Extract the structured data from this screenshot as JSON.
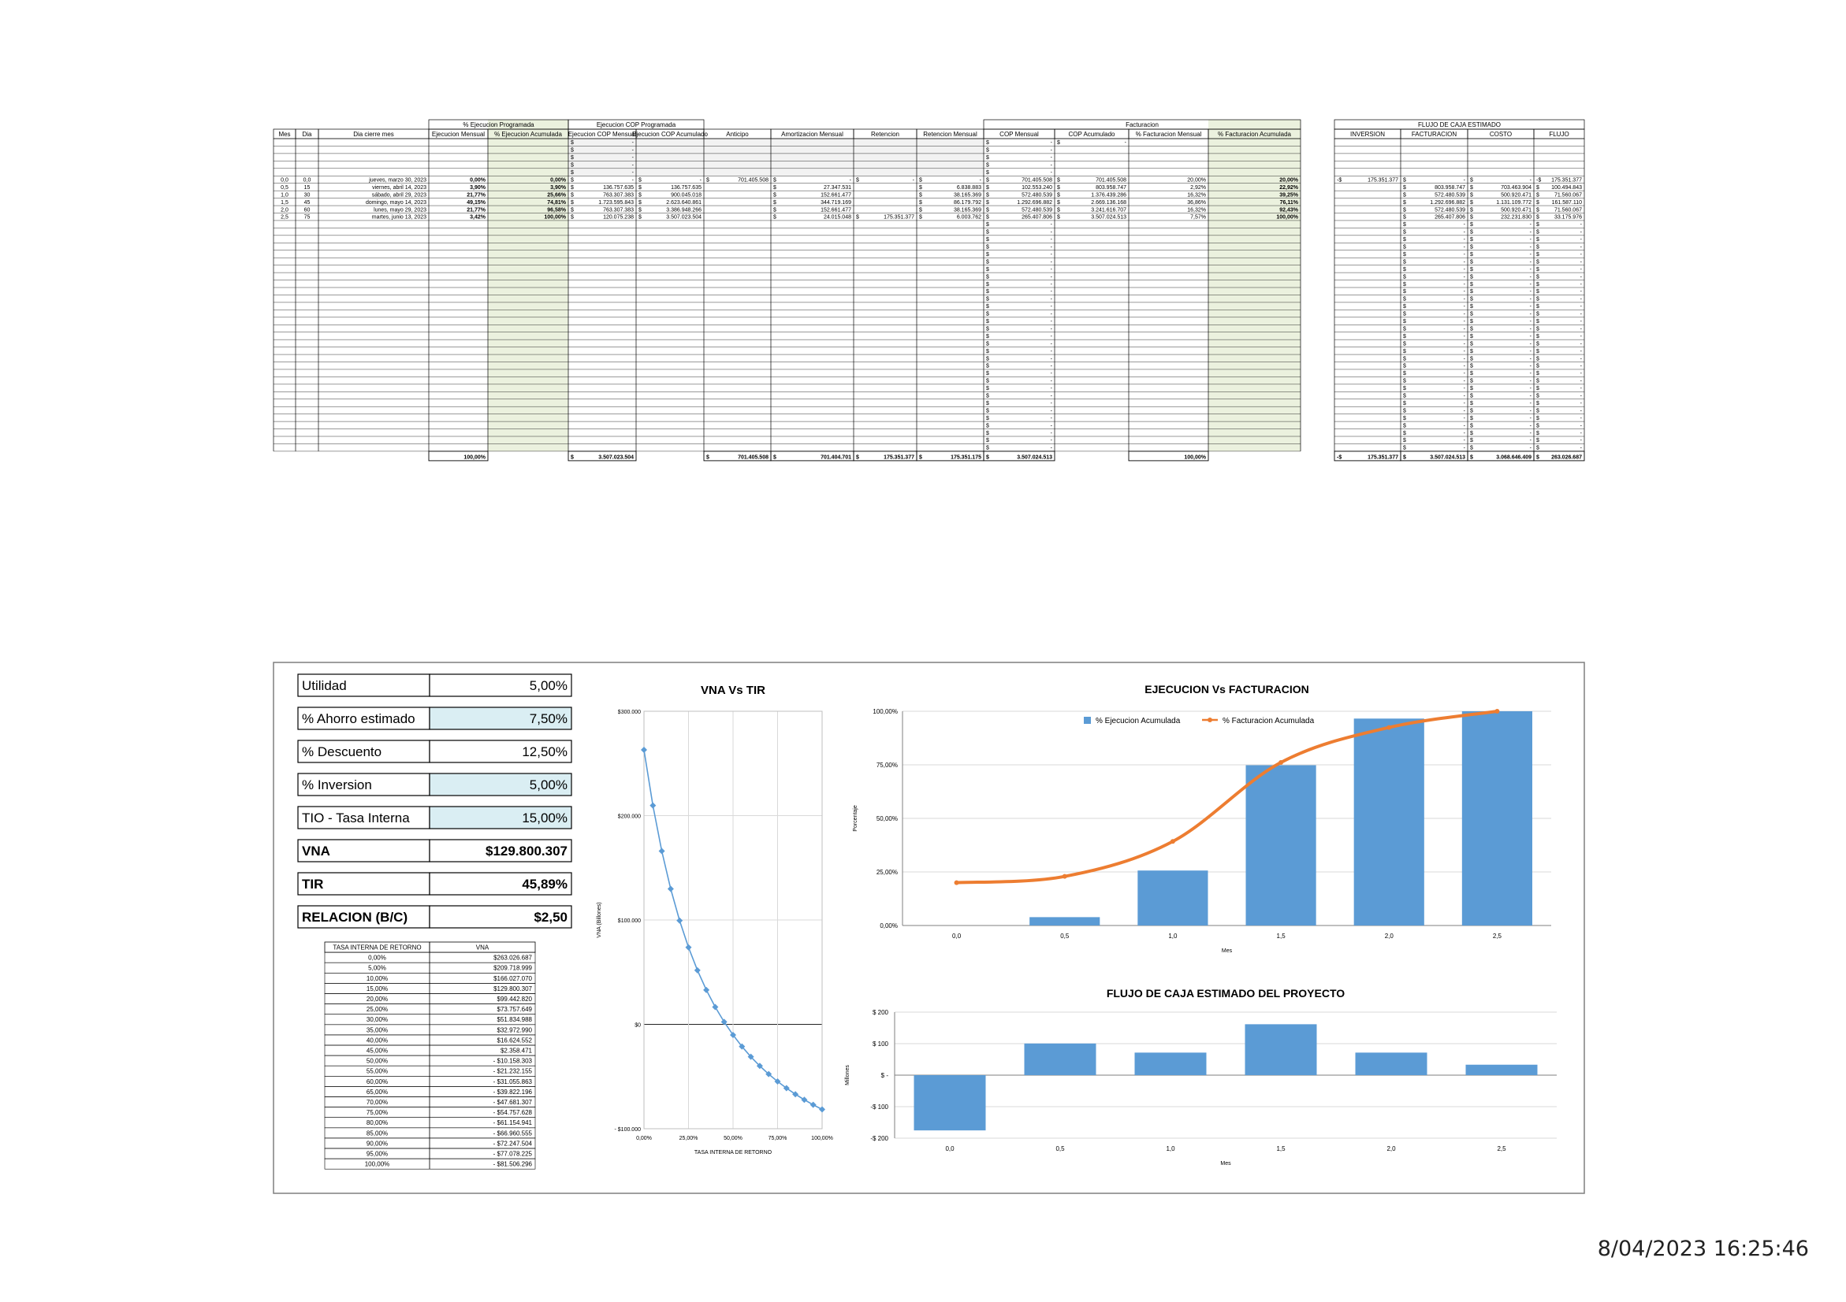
{
  "main_table": {
    "group_headers": {
      "pct_programada": "% Ejecucion Programada",
      "cop_programada": "Ejecucion COP Programada",
      "facturacion": "Facturacion"
    },
    "headers": [
      "Mes",
      "Dia",
      "Dia cierre mes",
      "Ejecucion Mensual",
      "% Ejecucion Acumulada",
      "Ejecucion COP Mensual",
      "Ejecucion COP Acumulado",
      "Anticipo",
      "Amortizacion Mensual",
      "Retencion",
      "Retencion Mensual",
      "COP Mensual",
      "COP Acumulado",
      "% Facturacion Mensual",
      "% Facturacion Acumulada"
    ],
    "top_rows": [
      [
        "",
        "",
        "",
        "",
        "",
        "$      -",
        "",
        "",
        "",
        "",
        "",
        "$      -",
        "$      -",
        "",
        ""
      ],
      [
        "",
        "",
        "",
        "",
        "",
        "$      -",
        "",
        "",
        "",
        "",
        "",
        "$      -",
        "",
        "",
        ""
      ],
      [
        "",
        "",
        "",
        "",
        "",
        "$      -",
        "",
        "",
        "",
        "",
        "",
        "$      -",
        "",
        "",
        ""
      ],
      [
        "",
        "",
        "",
        "",
        "",
        "$      -",
        "",
        "",
        "",
        "",
        "",
        "$      -",
        "",
        "",
        ""
      ],
      [
        "",
        "",
        "",
        "",
        "",
        "$      -",
        "",
        "",
        "",
        "",
        "",
        "$      -",
        "",
        "",
        ""
      ]
    ],
    "rows": [
      [
        "0,0",
        "0,0",
        "jueves, marzo 30, 2023",
        "0,00%",
        "0,00%",
        "$      -",
        "$      -",
        "$  701.405.508",
        "$      -",
        "$      -",
        "$      -",
        "$  701.405.508",
        "$  701.405.508",
        "20,00%",
        "20,00%"
      ],
      [
        "0,5",
        "15",
        "viernes, abril 14, 2023",
        "3,90%",
        "3,90%",
        "$  136.757.635",
        "$  136.757.635",
        "",
        "$  27.347.531",
        "",
        "$  6.838.883",
        "$  102.553.240",
        "$  803.958.747",
        "2,92%",
        "22,92%"
      ],
      [
        "1,0",
        "30",
        "sábado, abril 29, 2023",
        "21,77%",
        "25,66%",
        "$  763.307.383",
        "$  900.045.018",
        "",
        "$  152.661.477",
        "",
        "$  38.165.369",
        "$  572.480.539",
        "$  1.376.439.286",
        "16,32%",
        "39,25%"
      ],
      [
        "1,5",
        "45",
        "domingo, mayo 14, 2023",
        "49,15%",
        "74,81%",
        "$  1.723.595.843",
        "$  2.623.640.861",
        "",
        "$  344.719.169",
        "",
        "$  86.179.792",
        "$  1.292.696.882",
        "$  2.669.136.168",
        "36,86%",
        "76,11%"
      ],
      [
        "2,0",
        "60",
        "lunes, mayo 29, 2023",
        "21,77%",
        "96,58%",
        "$  763.307.383",
        "$  3.386.948.266",
        "",
        "$  152.661.477",
        "",
        "$  38.165.369",
        "$  572.480.539",
        "$  3.241.616.707",
        "16,32%",
        "92,43%"
      ],
      [
        "2,5",
        "75",
        "martes, junio 13, 2023",
        "3,42%",
        "100,00%",
        "$  120.075.238",
        "$  3.507.023.504",
        "",
        "$  24.015.048",
        "$  175.351.377",
        "$  6.003.762",
        "$  265.407.806",
        "$  3.507.024.513",
        "7,57%",
        "100,00%"
      ]
    ],
    "filler_cop_mensual": "$      -",
    "totals": [
      "",
      "",
      "",
      "100,00%",
      "",
      "$  3.507.023.504",
      "",
      "$  701.405.508",
      "$  701.404.701",
      "$  175.351.377",
      "$  175.351.175",
      "$  3.507.024.513",
      "",
      "100,00%",
      ""
    ]
  },
  "flujo_table": {
    "title": "FLUJO DE CAJA ESTIMADO",
    "headers": [
      "INVERSION",
      "FACTURACION",
      "COSTO",
      "FLUJO"
    ],
    "rows": [
      [
        "-$  175.351.377",
        "$      -",
        "$      -",
        "-$ 175.351.377"
      ],
      [
        "",
        "$  803.958.747",
        "$  703.463.904",
        "$ 100.494.843"
      ],
      [
        "",
        "$  572.480.539",
        "$  500.920.471",
        "$  71.560.067"
      ],
      [
        "",
        "$  1.292.696.882",
        "$  1.131.109.772",
        "$ 161.587.110"
      ],
      [
        "",
        "$  572.480.539",
        "$  500.920.471",
        "$  71.560.067"
      ],
      [
        "",
        "$  265.407.806",
        "$  232.231.830",
        "$  33.175.976"
      ]
    ],
    "filler_cell": "$      -",
    "totals": [
      "-$  175.351.377",
      "$  3.507.024.513",
      "$  3.068.646.409",
      "$ 263.026.687"
    ]
  },
  "params": [
    {
      "label": "Utilidad",
      "value": "5,00%",
      "highlight": false
    },
    {
      "label": "% Ahorro estimado",
      "value": "7,50%",
      "highlight": true
    },
    {
      "label": "% Descuento",
      "value": "12,50%",
      "highlight": false
    },
    {
      "label": "% Inversion",
      "value": "5,00%",
      "highlight": true
    },
    {
      "label": "TIO - Tasa Interna",
      "value": "15,00%",
      "highlight": true
    },
    {
      "label": "VNA",
      "value": "$129.800.307",
      "highlight": false
    },
    {
      "label": "TIR",
      "value": "45,89%",
      "highlight": false
    },
    {
      "label": "RELACION (B/C)",
      "value": "$2,50",
      "highlight": false
    }
  ],
  "tir_table": {
    "headers": [
      "TASA INTERNA DE RETORNO",
      "VNA"
    ],
    "rows": [
      [
        "0,00%",
        "$263.026.687"
      ],
      [
        "5,00%",
        "$209.718.999"
      ],
      [
        "10,00%",
        "$166.027.070"
      ],
      [
        "15,00%",
        "$129.800.307"
      ],
      [
        "20,00%",
        "$99.442.820"
      ],
      [
        "25,00%",
        "$73.757.649"
      ],
      [
        "30,00%",
        "$51.834.988"
      ],
      [
        "35,00%",
        "$32.972.990"
      ],
      [
        "40,00%",
        "$16.624.552"
      ],
      [
        "45,00%",
        "$2.358.471"
      ],
      [
        "50,00%",
        "- $10.158.303"
      ],
      [
        "55,00%",
        "- $21.232.155"
      ],
      [
        "60,00%",
        "- $31.055.863"
      ],
      [
        "65,00%",
        "- $39.822.196"
      ],
      [
        "70,00%",
        "- $47.681.307"
      ],
      [
        "75,00%",
        "- $54.757.628"
      ],
      [
        "80,00%",
        "- $61.154.941"
      ],
      [
        "85,00%",
        "- $66.960.555"
      ],
      [
        "90,00%",
        "- $72.247.504"
      ],
      [
        "95,00%",
        "- $77.078.225"
      ],
      [
        "100,00%",
        "- $81.506.296"
      ]
    ]
  },
  "chart_data": [
    {
      "type": "line",
      "title": "VNA Vs TIR",
      "xlabel": "TASA INTERNA DE RETORNO",
      "ylabel": "VNA (Billones)",
      "x": [
        0,
        5,
        10,
        15,
        20,
        25,
        30,
        35,
        40,
        45,
        50,
        55,
        60,
        65,
        70,
        75,
        80,
        85,
        90,
        95,
        100
      ],
      "y": [
        263.03,
        209.72,
        166.03,
        129.8,
        99.44,
        73.76,
        51.83,
        32.97,
        16.62,
        2.36,
        -10.16,
        -21.23,
        -31.06,
        -39.82,
        -47.68,
        -54.76,
        -61.15,
        -66.96,
        -72.25,
        -77.08,
        -81.51
      ],
      "xlim": [
        0,
        100
      ],
      "ylim": [
        -100,
        300
      ],
      "xticks": [
        "0,00%",
        "25,00%",
        "50,00%",
        "75,00%",
        "100,00%"
      ],
      "yticks": [
        "- $100.000",
        "$0",
        "$100.000",
        "$200.000",
        "$300.000"
      ],
      "color": "#5b9bd5",
      "grid": true
    },
    {
      "type": "bar",
      "title": "EJECUCION Vs FACTURACION",
      "xlabel": "Mes",
      "ylabel": "Porcentaje",
      "categories": [
        "0,0",
        "0,5",
        "1,0",
        "1,5",
        "2,0",
        "2,5"
      ],
      "series": [
        {
          "name": "% Ejecucion Acumulada",
          "type": "bar",
          "color": "#5b9bd5",
          "values": [
            0,
            3.9,
            25.66,
            74.81,
            96.58,
            100
          ]
        },
        {
          "name": "% Facturacion Acumulada",
          "type": "line",
          "color": "#ed7d31",
          "values": [
            20,
            22.92,
            39.25,
            76.11,
            92.43,
            100
          ]
        }
      ],
      "ylim": [
        0,
        100
      ],
      "yticks": [
        "0,00%",
        "25,00%",
        "50,00%",
        "75,00%",
        "100,00%"
      ],
      "legend": "top",
      "grid": true
    },
    {
      "type": "bar",
      "title": "FLUJO DE CAJA ESTIMADO DEL PROYECTO",
      "xlabel": "Mes",
      "ylabel": "Millones",
      "categories": [
        "0,0",
        "0,5",
        "1,0",
        "1,5",
        "2,0",
        "2,5"
      ],
      "values": [
        -175.35,
        100.49,
        71.56,
        161.59,
        71.56,
        33.18
      ],
      "ylim": [
        -200,
        200
      ],
      "yticks": [
        "-$ 200",
        "-$ 100",
        "$ -",
        "$ 100",
        "$ 200"
      ],
      "color": "#5b9bd5",
      "grid": true
    }
  ],
  "footer": {
    "timestamp": "8/04/2023 16:25:46"
  }
}
